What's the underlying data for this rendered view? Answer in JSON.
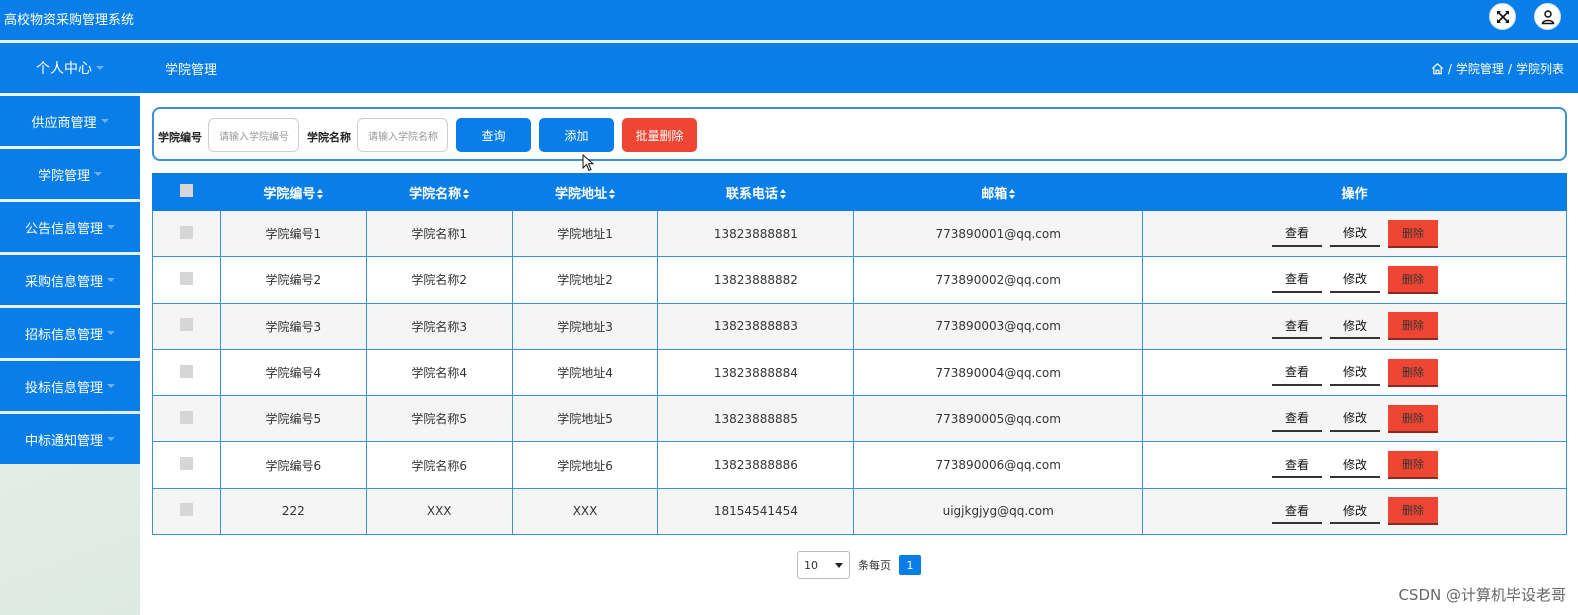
{
  "app": {
    "title": "高校物资采购管理系统",
    "accent_color": "#0a7ee8",
    "danger_color": "#ef4634",
    "icons": [
      "fullscreen-icon",
      "user-icon",
      "home-icon"
    ]
  },
  "header": {
    "first_menu": "个人中心",
    "page_title": "学院管理",
    "breadcrumb": [
      "学院管理",
      "学院列表"
    ],
    "breadcrumb_sep": "/"
  },
  "sidebar": {
    "items": [
      {
        "label": "供应商管理"
      },
      {
        "label": "学院管理"
      },
      {
        "label": "公告信息管理"
      },
      {
        "label": "采购信息管理"
      },
      {
        "label": "招标信息管理"
      },
      {
        "label": "投标信息管理"
      },
      {
        "label": "中标通知管理"
      }
    ]
  },
  "search": {
    "code_label": "学院编号",
    "code_placeholder": "请输入学院编号",
    "name_label": "学院名称",
    "name_placeholder": "请输入学院名称",
    "query_label": "查询",
    "add_label": "添加",
    "batch_delete_label": "批量删除"
  },
  "table": {
    "columns": [
      "学院编号",
      "学院名称",
      "学院地址",
      "联系电话",
      "邮箱",
      "操作"
    ],
    "rows": [
      {
        "code": "学院编号1",
        "name": "学院名称1",
        "address": "学院地址1",
        "phone": "13823888881",
        "email": "773890001@qq.com"
      },
      {
        "code": "学院编号2",
        "name": "学院名称2",
        "address": "学院地址2",
        "phone": "13823888882",
        "email": "773890002@qq.com"
      },
      {
        "code": "学院编号3",
        "name": "学院名称3",
        "address": "学院地址3",
        "phone": "13823888883",
        "email": "773890003@qq.com"
      },
      {
        "code": "学院编号4",
        "name": "学院名称4",
        "address": "学院地址4",
        "phone": "13823888884",
        "email": "773890004@qq.com"
      },
      {
        "code": "学院编号5",
        "name": "学院名称5",
        "address": "学院地址5",
        "phone": "13823888885",
        "email": "773890005@qq.com"
      },
      {
        "code": "学院编号6",
        "name": "学院名称6",
        "address": "学院地址6",
        "phone": "13823888886",
        "email": "773890006@qq.com"
      },
      {
        "code": "222",
        "name": "XXX",
        "address": "XXX",
        "phone": "18154541454",
        "email": "uigjkgjyg@qq.com"
      }
    ],
    "actions": {
      "view": "查看",
      "edit": "修改",
      "delete": "删除"
    }
  },
  "pagination": {
    "page_size": "10",
    "per_page_label": "条每页",
    "current_page": "1"
  },
  "watermark": "CSDN @计算机毕设老哥"
}
